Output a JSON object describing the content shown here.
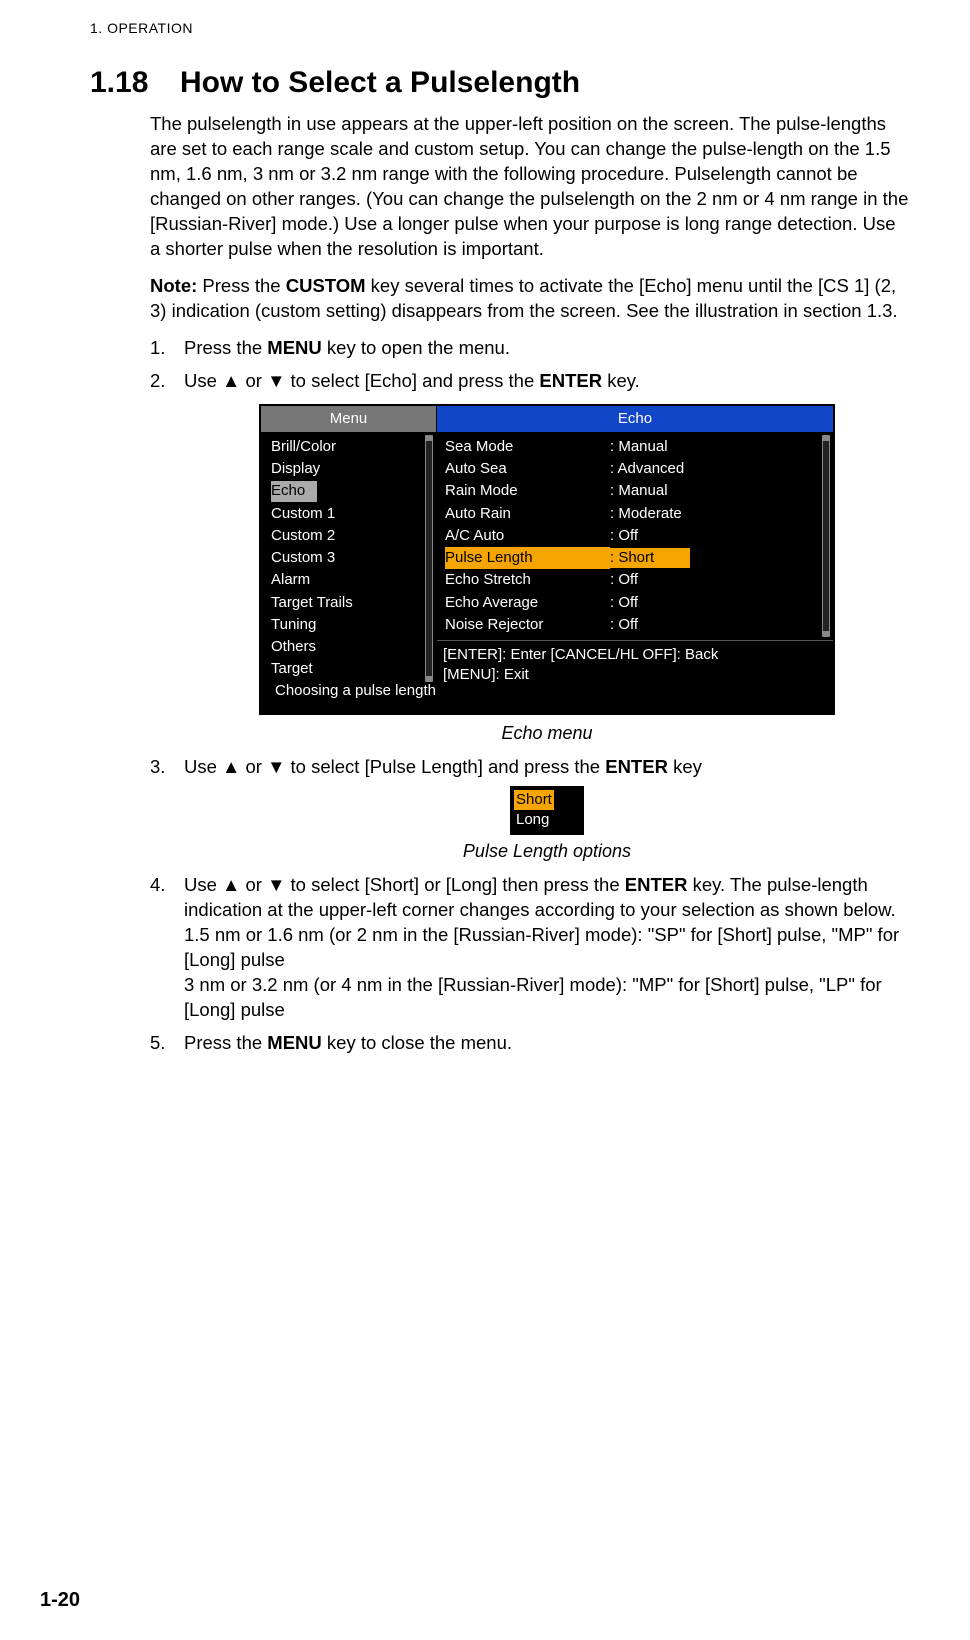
{
  "header": "1.  OPERATION",
  "section_number": "1.18",
  "section_title": "How to Select a Pulselength",
  "intro_para": "The pulselength in use appears at the upper-left position on the screen. The pulse-lengths are set to each range scale and custom setup. You can change the pulse-length on the 1.5 nm, 1.6 nm, 3 nm or 3.2 nm range with the following procedure. Pulselength cannot be changed on other ranges. (You can change the pulselength on the 2 nm or 4 nm range in the [Russian-River] mode.) Use a longer pulse when your purpose is long range detection. Use a shorter pulse when the resolution is important.",
  "note_label": "Note:",
  "note_body_a": " Press the ",
  "note_key": "CUSTOM",
  "note_body_b": " key several times to activate the [Echo] menu until the [CS 1] (2, 3) indication (custom setting) disappears from the screen. See the illustration in section 1.3.",
  "step1_a": "Press the ",
  "step1_key": "MENU",
  "step1_b": " key to open the menu.",
  "step2_a": "Use ▲ or ▼ to select [Echo] and press the ",
  "step2_key": "ENTER",
  "step2_b": " key.",
  "menu": {
    "left_title": "Menu",
    "left_items": [
      "Brill/Color",
      "Display",
      "Echo",
      "Custom 1",
      "Custom 2",
      "Custom 3",
      "Alarm",
      "Target Trails",
      "Tuning",
      "Others",
      "Target"
    ],
    "left_selected_index": 2,
    "right_title": "Echo",
    "right_rows": [
      {
        "label": "Sea Mode",
        "value": ": Manual"
      },
      {
        "label": "Auto Sea",
        "value": ": Advanced"
      },
      {
        "label": "Rain Mode",
        "value": ": Manual"
      },
      {
        "label": "Auto Rain",
        "value": ": Moderate"
      },
      {
        "label": "A/C Auto",
        "value": ": Off"
      },
      {
        "label": "Pulse Length",
        "value": ": Short"
      },
      {
        "label": "Echo Stretch",
        "value": ": Off"
      },
      {
        "label": "Echo Average",
        "value": ": Off"
      },
      {
        "label": "Noise Rejector",
        "value": ": Off"
      }
    ],
    "right_selected_index": 5,
    "help_line1": "[ENTER]: Enter [CANCEL/HL OFF]: Back",
    "help_line2": "[MENU]: Exit",
    "footer": "Choosing a pulse length"
  },
  "caption1": "Echo menu",
  "step3_a": "Use ▲ or ▼ to select [Pulse Length] and press the ",
  "step3_key": "ENTER",
  "step3_b": " key",
  "options": {
    "opt1": "Short",
    "opt2": "Long"
  },
  "caption2": "Pulse Length options",
  "step4_a": "Use ▲ or ▼ to select [Short] or [Long] then press the ",
  "step4_key": "ENTER",
  "step4_b": " key. The pulse-length indication at the upper-left corner changes according to your selection as shown below.",
  "step4_line2": "1.5 nm or 1.6 nm (or 2 nm in the [Russian-River] mode): \"SP\" for [Short] pulse, \"MP\" for [Long] pulse",
  "step4_line3": "3 nm or 3.2 nm (or 4 nm in the [Russian-River] mode): \"MP\" for [Short] pulse, \"LP\" for [Long] pulse",
  "step5_a": "Press the ",
  "step5_key": "MENU",
  "step5_b": " key to close the menu.",
  "page_number": "1-20"
}
